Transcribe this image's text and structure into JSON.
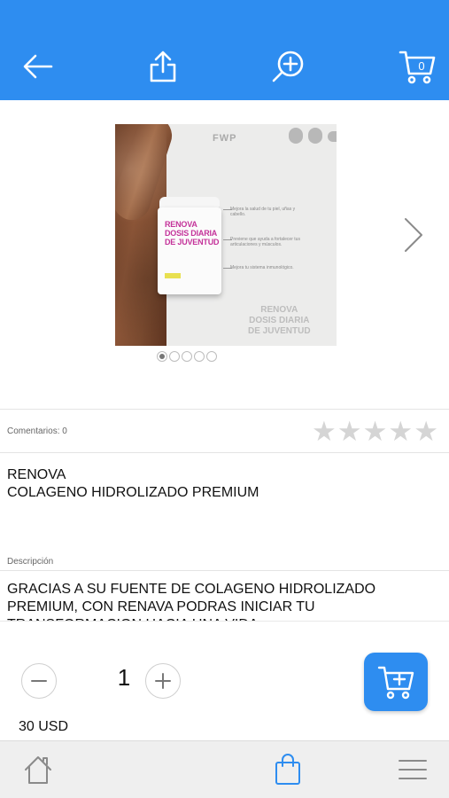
{
  "header": {
    "icons": [
      "back-arrow-icon",
      "share-icon",
      "zoom-in-icon",
      "cart-icon"
    ],
    "cart_count": "0"
  },
  "gallery": {
    "image": {
      "brand": "FWP",
      "jar_lines": [
        "RENOVA",
        "DOSIS DIARIA",
        "DE JUVENTUD"
      ],
      "bullets": [
        "Mejora la salud de tu piel, uñas y cabello.",
        "Previene que ayuda a fortalecer tus articulaciones y músculos.",
        "Mejora tu sistema inmunológico."
      ],
      "caption_lines": [
        "RENOVA",
        "DOSIS DIARIA",
        "DE JUVENTUD"
      ]
    },
    "dots_total": 5,
    "dots_active": 0
  },
  "reviews": {
    "label": "Comentarios: 0",
    "rating": 0,
    "max_rating": 5
  },
  "product": {
    "title_line1": "RENOVA",
    "title_line2": "COLAGENO HIDROLIZADO PREMIUM",
    "description_label": "Descripción",
    "description": "GRACIAS A SU FUENTE DE COLAGENO HIDROLIZADO PREMIUM, CON RENAVA PODRAS INICIAR TU TRANSFORMACION HACIA UNA VIDA"
  },
  "purchase": {
    "quantity": "1",
    "price": "30 USD"
  },
  "colors": {
    "primary": "#2e8df0",
    "nav_bg": "#efefef",
    "star": "#d5d5d5"
  },
  "bottom_nav": {
    "icons": [
      "home-icon",
      "shopping-bag-icon",
      "menu-icon"
    ],
    "active": "shopping-bag-icon"
  }
}
